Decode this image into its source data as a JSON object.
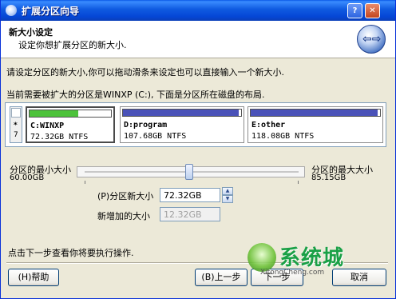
{
  "window": {
    "title": "扩展分区向导",
    "controls": {
      "help": "?",
      "close": "✕"
    }
  },
  "header": {
    "title": "新大小设定",
    "subtitle": "设定你想扩展分区的新大小.",
    "icon": "back-forward-arrows-icon"
  },
  "intro_text": "请设定分区的新大小,你可以拖动滑条来设定也可以直接输入一个新大小.",
  "disk_info_text": "当前需要被扩大的分区是WINXP (C:), 下面是分区所在磁盘的布局.",
  "disk_map": {
    "prefix": {
      "star": "*",
      "num": "7"
    },
    "partitions": [
      {
        "name": "C:WINXP",
        "size": "72.32GB NTFS",
        "used_fraction": 0.6,
        "color": "#4cc23a",
        "selected": true
      },
      {
        "name": "D:program",
        "size": "107.68GB NTFS",
        "used_fraction": 0.98,
        "color": "#4a52b8",
        "selected": false
      },
      {
        "name": "E:other",
        "size": "118.08GB NTFS",
        "used_fraction": 0.98,
        "color": "#4a52b8",
        "selected": false
      }
    ]
  },
  "slider": {
    "min_label": "分区的最小大小",
    "min_value": "60.00GB",
    "max_label": "分区的最大大小",
    "max_value": "85.15GB",
    "position_fraction": 0.49
  },
  "fields": {
    "new_size_label": "(P)分区新大小",
    "new_size_value": "72.32GB",
    "added_label": "新增加的大小",
    "added_value": "12.32GB"
  },
  "footer_text": "点击下一步查看你将要执行操作.",
  "buttons": {
    "help": "(H)帮助",
    "back": "(B)上一步",
    "next": "下一步",
    "cancel": "取消"
  },
  "watermark": {
    "brand": "系统城",
    "url": "XitongCheng.com"
  }
}
